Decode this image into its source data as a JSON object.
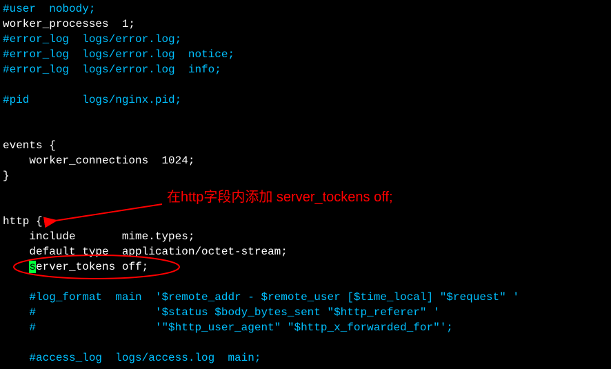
{
  "lines": [
    [
      {
        "c": "cmt",
        "t": "#user  nobody;"
      }
    ],
    [
      {
        "c": "txt",
        "t": "worker_processes  1;"
      }
    ],
    [
      {
        "c": "cmt",
        "t": "#error_log  logs/error.log;"
      }
    ],
    [
      {
        "c": "cmt",
        "t": "#error_log  logs/error.log  notice;"
      }
    ],
    [
      {
        "c": "cmt",
        "t": "#error_log  logs/error.log  info;"
      }
    ],
    [
      {
        "c": "txt",
        "t": ""
      }
    ],
    [
      {
        "c": "cmt",
        "t": "#pid        logs/nginx.pid;"
      }
    ],
    [
      {
        "c": "txt",
        "t": ""
      }
    ],
    [
      {
        "c": "txt",
        "t": ""
      }
    ],
    [
      {
        "c": "txt",
        "t": "events {"
      }
    ],
    [
      {
        "c": "txt",
        "t": "    worker_connections  1024;"
      }
    ],
    [
      {
        "c": "txt",
        "t": "}"
      }
    ],
    [
      {
        "c": "txt",
        "t": ""
      }
    ],
    [
      {
        "c": "txt",
        "t": ""
      }
    ],
    [
      {
        "c": "txt",
        "t": "http {"
      }
    ],
    [
      {
        "c": "txt",
        "t": "    include       mime.types;"
      }
    ],
    [
      {
        "c": "txt",
        "t": "    default_type  application/octet-stream;"
      }
    ],
    [
      {
        "c": "txt",
        "t": "    "
      },
      {
        "c": "cursor",
        "t": "s"
      },
      {
        "c": "txt",
        "t": "erver_tokens off;"
      }
    ],
    [
      {
        "c": "txt",
        "t": ""
      }
    ],
    [
      {
        "c": "txt",
        "t": "    "
      },
      {
        "c": "cmt",
        "t": "#log_format  main  '$remote_addr - $remote_user [$time_local] \"$request\" '"
      }
    ],
    [
      {
        "c": "txt",
        "t": "    "
      },
      {
        "c": "cmt",
        "t": "#                  '$status $body_bytes_sent \"$http_referer\" '"
      }
    ],
    [
      {
        "c": "txt",
        "t": "    "
      },
      {
        "c": "cmt",
        "t": "#                  '\"$http_user_agent\" \"$http_x_forwarded_for\"';"
      }
    ],
    [
      {
        "c": "txt",
        "t": ""
      }
    ],
    [
      {
        "c": "txt",
        "t": "    "
      },
      {
        "c": "cmt",
        "t": "#access_log  logs/access.log  main;"
      }
    ]
  ],
  "annotation_text": "在http字段内添加 server_tockens off;"
}
